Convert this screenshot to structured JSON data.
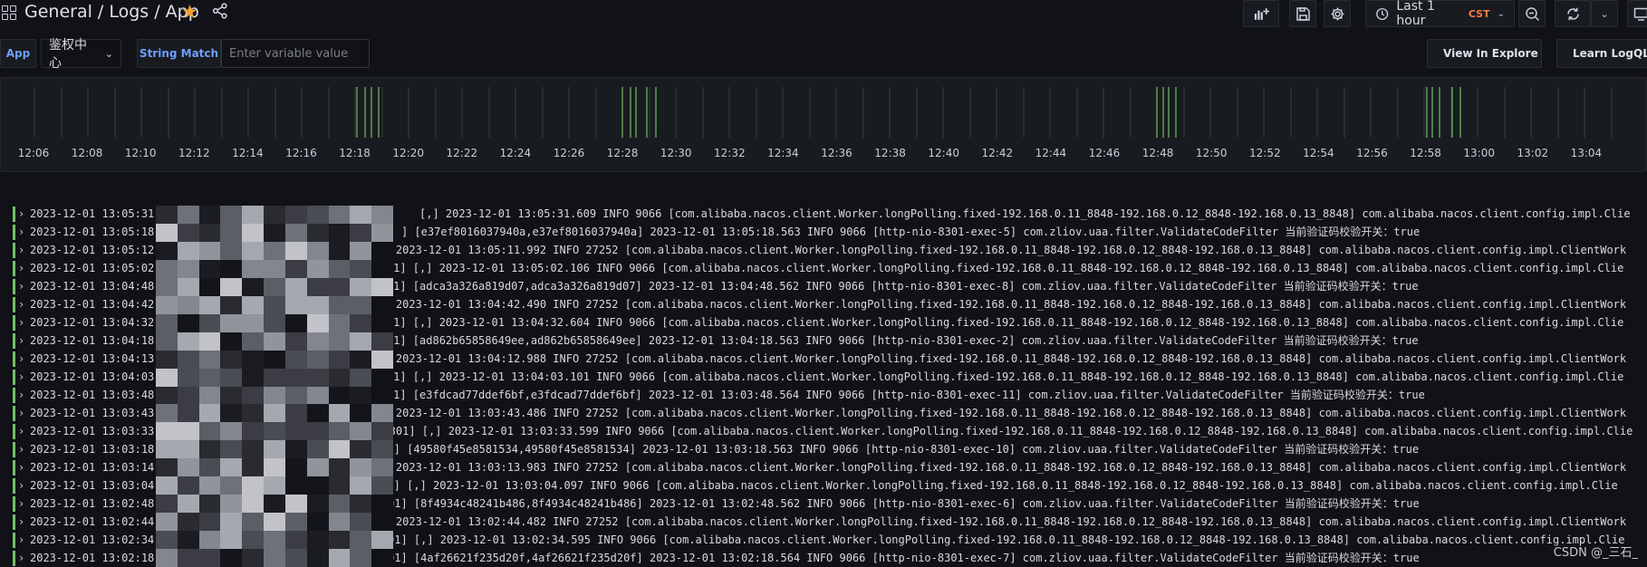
{
  "header": {
    "breadcrumb": "General  / Logs / App",
    "starred": true,
    "time_range": "Last 1 hour",
    "timezone": "CST"
  },
  "icons": {
    "apps": "apps-grid-icon",
    "star": "star-icon",
    "share": "share-icon",
    "add_panel": "add-panel-icon",
    "save": "save-icon",
    "settings": "gear-icon",
    "clock": "clock-icon",
    "zoom_out": "zoom-out-icon",
    "refresh": "refresh-icon",
    "tv": "tv-mode-icon"
  },
  "variables": {
    "app_label": "App",
    "app_value": "鉴权中心",
    "string_match_label": "String Match",
    "string_match_placeholder": "Enter variable value",
    "string_match_value": ""
  },
  "actions": {
    "view_in_explore": "View In Explore",
    "learn_logql": "Learn LogQL"
  },
  "histogram": {
    "ticks": [
      "12:06",
      "12:08",
      "12:10",
      "12:12",
      "12:14",
      "12:16",
      "12:18",
      "12:20",
      "12:22",
      "12:24",
      "12:26",
      "12:28",
      "12:30",
      "12:32",
      "12:34",
      "12:36",
      "12:38",
      "12:40",
      "12:42",
      "12:44",
      "12:46",
      "12:48",
      "12:50",
      "12:52",
      "12:54",
      "12:56",
      "12:58",
      "13:00",
      "13:02",
      "13:04"
    ],
    "bar_color": "#73bf69",
    "grid_color": "#3a3d45"
  },
  "logs": [
    {
      "time": "2023-12-01 13:05:31",
      "line": "[,] 2023-12-01 13:05:31.609 INFO 9066 [com.alibaba.nacos.client.Worker.longPolling.fixed-192.168.0.11_8848-192.168.0.12_8848-192.168.0.13_8848] com.alibaba.nacos.client.config.impl.Clie"
    },
    {
      "time": "2023-12-01 13:05:18",
      "line": "] [e37ef8016037940a,e37ef8016037940a] 2023-12-01 13:05:18.563 INFO 9066 [http-nio-8301-exec-5] com.zliov.uaa.filter.ValidateCodeFilter 当前验证码校验开关：true"
    },
    {
      "time": "2023-12-01 13:05:12",
      "line": "[,] 2023-12-01 13:05:11.992 INFO 27252 [com.alibaba.nacos.client.Worker.longPolling.fixed-192.168.0.11_8848-192.168.0.12_8848-192.168.0.13_8848] com.alibaba.nacos.client.config.impl.ClientWork"
    },
    {
      "time": "2023-12-01 13:05:02",
      "line": "8:8301] [,] 2023-12-01 13:05:02.106 INFO 9066 [com.alibaba.nacos.client.Worker.longPolling.fixed-192.168.0.11_8848-192.168.0.12_8848-192.168.0.13_8848] com.alibaba.nacos.client.config.impl.Clie"
    },
    {
      "time": "2023-12-01 13:04:48",
      "line": "8:8301] [adca3a326a819d07,adca3a326a819d07] 2023-12-01 13:04:48.562 INFO 9066 [http-nio-8301-exec-8] com.zliov.uaa.filter.ValidateCodeFilter 当前验证码校验开关：true"
    },
    {
      "time": "2023-12-01 13:04:42",
      "line": "[,] 2023-12-01 13:04:42.490 INFO 27252 [com.alibaba.nacos.client.Worker.longPolling.fixed-192.168.0.11_8848-192.168.0.12_8848-192.168.0.13_8848] com.alibaba.nacos.client.config.impl.ClientWork"
    },
    {
      "time": "2023-12-01 13:04:32",
      "line": "8:8301] [,] 2023-12-01 13:04:32.604 INFO 9066 [com.alibaba.nacos.client.Worker.longPolling.fixed-192.168.0.11_8848-192.168.0.12_8848-192.168.0.13_8848] com.alibaba.nacos.client.config.impl.Clie"
    },
    {
      "time": "2023-12-01 13:04:18",
      "line": "8:8301] [ad862b65858649ee,ad862b65858649ee] 2023-12-01 13:04:18.563 INFO 9066 [http-nio-8301-exec-2] com.zliov.uaa.filter.ValidateCodeFilter 当前验证码校验开关：true"
    },
    {
      "time": "2023-12-01 13:04:13",
      "line": "[,] 2023-12-01 13:04:12.988 INFO 27252 [com.alibaba.nacos.client.Worker.longPolling.fixed-192.168.0.11_8848-192.168.0.12_8848-192.168.0.13_8848] com.alibaba.nacos.client.config.impl.ClientWork"
    },
    {
      "time": "2023-12-01 13:04:03",
      "line": "8:8301] [,] 2023-12-01 13:04:03.101 INFO 9066 [com.alibaba.nacos.client.Worker.longPolling.fixed-192.168.0.11_8848-192.168.0.12_8848-192.168.0.13_8848] com.alibaba.nacos.client.config.impl.Clie"
    },
    {
      "time": "2023-12-01 13:03:48",
      "line": "8:8301] [e3fdcad77ddef6bf,e3fdcad77ddef6bf] 2023-12-01 13:03:48.564 INFO 9066 [http-nio-8301-exec-11] com.zliov.uaa.filter.ValidateCodeFilter 当前验证码校验开关：true"
    },
    {
      "time": "2023-12-01 13:03:43",
      "line": "[,] 2023-12-01 13:03:43.486 INFO 27252 [com.alibaba.nacos.client.Worker.longPolling.fixed-192.168.0.11_8848-192.168.0.12_8848-192.168.0.13_8848] com.alibaba.nacos.client.config.impl.ClientWork"
    },
    {
      "time": "2023-12-01 13:03:33",
      "line": "8:8301] [,] 2023-12-01 13:03:33.599 INFO 9066 [com.alibaba.nacos.client.Worker.longPolling.fixed-192.168.0.11_8848-192.168.0.12_8848-192.168.0.13_8848] com.alibaba.nacos.client.config.impl.Clie"
    },
    {
      "time": "2023-12-01 13:03:18",
      "line": "301] [49580f45e8581534,49580f45e8581534] 2023-12-01 13:03:18.563 INFO 9066 [http-nio-8301-exec-10] com.zliov.uaa.filter.ValidateCodeFilter 当前验证码校验开关：true"
    },
    {
      "time": "2023-12-01 13:03:14",
      "line": "[,] 2023-12-01 13:03:13.983 INFO 27252 [com.alibaba.nacos.client.Worker.longPolling.fixed-192.168.0.11_8848-192.168.0.12_8848-192.168.0.13_8848] com.alibaba.nacos.client.config.impl.ClientWork"
    },
    {
      "time": "2023-12-01 13:03:04",
      "line": "301] [,] 2023-12-01 13:03:04.097 INFO 9066 [com.alibaba.nacos.client.Worker.longPolling.fixed-192.168.0.11_8848-192.168.0.12_8848-192.168.0.13_8848] com.alibaba.nacos.client.config.impl.Clie"
    },
    {
      "time": "2023-12-01 13:02:48",
      "line": "01] [8f4934c48241b486,8f4934c48241b486] 2023-12-01 13:02:48.562 INFO 9066 [http-nio-8301-exec-6] com.zliov.uaa.filter.ValidateCodeFilter 当前验证码校验开关：true"
    },
    {
      "time": "2023-12-01 13:02:44",
      "line": "[,] 2023-12-01 13:02:44.482 INFO 27252 [com.alibaba.nacos.client.Worker.longPolling.fixed-192.168.0.11_8848-192.168.0.12_8848-192.168.0.13_8848] com.alibaba.nacos.client.config.impl.ClientWork"
    },
    {
      "time": "2023-12-01 13:02:34",
      "line": "01] [,] 2023-12-01 13:02:34.595 INFO 9066 [com.alibaba.nacos.client.Worker.longPolling.fixed-192.168.0.11_8848-192.168.0.12_8848-192.168.0.13_8848] com.alibaba.nacos.client.config.impl.Clie"
    },
    {
      "time": "2023-12-01 13:02:18",
      "line": "01] [4af26621f235d20f,4af26621f235d20f] 2023-12-01 13:02:18.564 INFO 9066 [http-nio-8301-exec-7] com.zliov.uaa.filter.ValidateCodeFilter 当前验证码校验开关：true"
    }
  ],
  "watermark": "CSDN @_三石_"
}
